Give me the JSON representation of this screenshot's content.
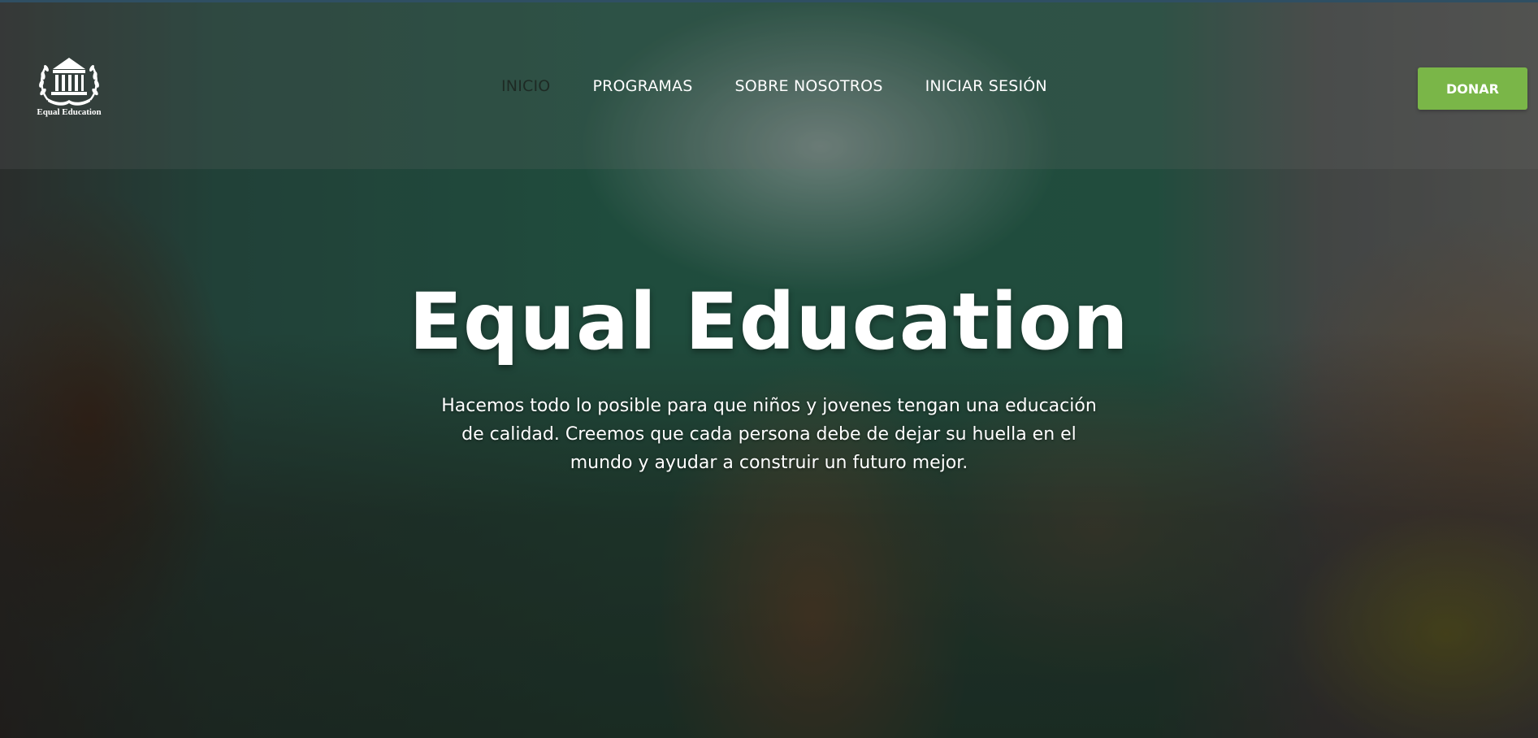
{
  "brand": {
    "logo_icon": "laurel-temple-icon",
    "name": "Equal Education"
  },
  "nav": {
    "items": [
      {
        "label": "INICIO",
        "active": true
      },
      {
        "label": "PROGRAMAS",
        "active": false
      },
      {
        "label": "SOBRE NOSOTROS",
        "active": false
      },
      {
        "label": "INICIAR SESIÓN",
        "active": false
      }
    ]
  },
  "header": {
    "donate_label": "DONAR"
  },
  "hero": {
    "title": "Equal Education",
    "text": "Hacemos todo lo posible para que niños y jovenes tengan una educación de calidad. Creemos que cada persona debe de dejar su huella en el mundo y ayudar a construir un futuro mejor."
  },
  "colors": {
    "accent": "#7ab648",
    "active_nav": "#1e2a24",
    "text": "#ffffff"
  }
}
